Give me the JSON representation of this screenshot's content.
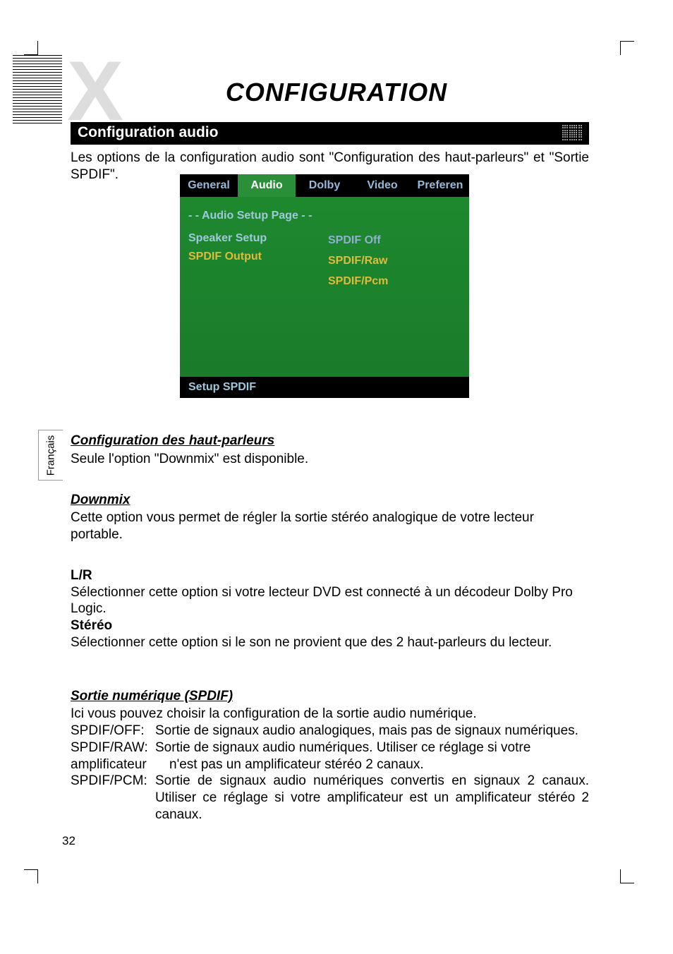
{
  "page_title": "CONFIGURATION",
  "section_title": "Configuration audio",
  "intro_text": "Les options de la configuration audio sont \"Configuration des haut-parleurs\" et \"Sortie SPDIF\".",
  "osd": {
    "tabs": [
      "General",
      "Audio",
      "Dolby",
      "Video",
      "Preferen"
    ],
    "active_tab_index": 1,
    "page_label": "- -  Audio Setup Page  - -",
    "items": [
      "Speaker Setup",
      "SPDIF Output"
    ],
    "selected_item_index": 1,
    "options": [
      "SPDIF Off",
      "SPDIF/Raw",
      "SPDIF/Pcm"
    ],
    "selected_option_index": 0,
    "footer": "Setup  SPDIF"
  },
  "language_tab": "Français",
  "sections": {
    "speaker": {
      "heading": "Configuration des haut-parleurs",
      "text": "Seule l'option \"Downmix\" est disponible."
    },
    "downmix": {
      "heading": "Downmix",
      "text": "Cette option vous permet de régler la sortie stéréo analogique de votre lecteur portable."
    },
    "lr": {
      "heading": "L/R",
      "text": "Sélectionner cette option si votre lecteur DVD est connecté à un décodeur Dolby Pro Logic."
    },
    "stereo": {
      "heading": "Stéréo",
      "text": "Sélectionner cette option si le son ne provient que des 2 haut-parleurs du lecteur."
    },
    "spdif": {
      "heading": "Sortie numérique (SPDIF)",
      "intro": "Ici vous pouvez choisir la configuration de la sortie audio numérique.",
      "rows": [
        {
          "label": "SPDIF/OFF:",
          "desc": "Sortie de signaux audio analogiques, mais pas de signaux numériques."
        },
        {
          "label": "SPDIF/RAW:",
          "desc": "Sortie de signaux audio numériques. Utiliser ce réglage si votre"
        },
        {
          "label": "amplificateur",
          "desc": "n'est pas un amplificateur stéréo 2 canaux."
        },
        {
          "label": "SPDIF/PCM:",
          "desc": "Sortie de signaux audio numériques convertis en signaux 2 canaux.  Utiliser ce réglage si votre amplificateur est un amplificateur stéréo 2 canaux."
        }
      ]
    }
  },
  "page_number": "32"
}
